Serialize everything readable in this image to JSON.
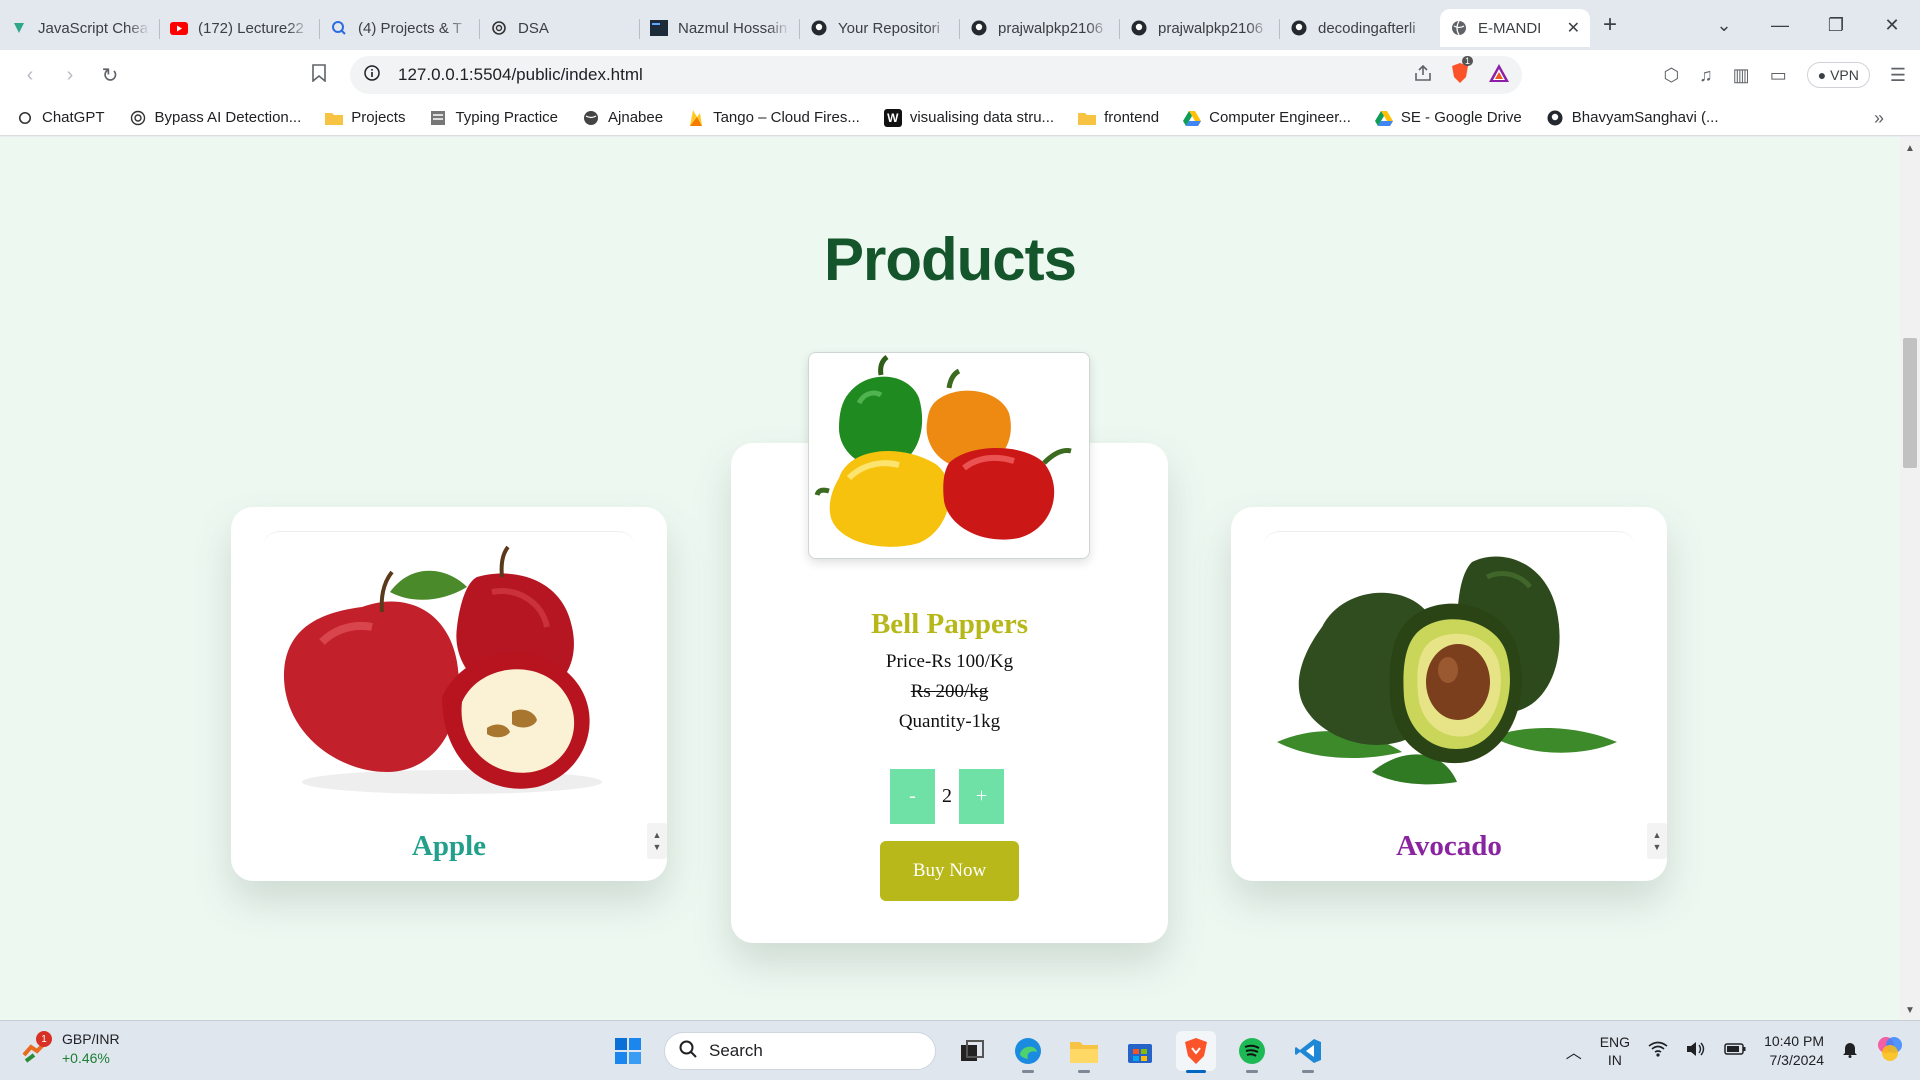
{
  "browser": {
    "tabs": [
      {
        "title": "JavaScript Chea",
        "icon": "javascript-site-icon",
        "active": false
      },
      {
        "title": "(172) Lecture22",
        "icon": "youtube-icon",
        "active": false
      },
      {
        "title": "(4) Projects & T",
        "icon": "projects-site-icon",
        "active": false
      },
      {
        "title": "DSA",
        "icon": "chatgpt-icon",
        "active": false
      },
      {
        "title": "Nazmul Hossain",
        "icon": "portfolio-site-icon",
        "active": false
      },
      {
        "title": "Your Repositori",
        "icon": "github-icon",
        "active": false
      },
      {
        "title": "prajwalpkp2106",
        "icon": "github-icon",
        "active": false
      },
      {
        "title": "prajwalpkp2106",
        "icon": "github-icon",
        "active": false
      },
      {
        "title": "decodingafterli",
        "icon": "github-icon",
        "active": false
      },
      {
        "title": "E-MANDI",
        "icon": "globe-icon",
        "active": true
      }
    ],
    "url": "127.0.0.1:5504/public/index.html",
    "vpn_label": "VPN",
    "shields_count": "1",
    "bookmarks": [
      {
        "label": "ChatGPT",
        "icon": "chatgpt-icon"
      },
      {
        "label": "Bypass AI Detection...",
        "icon": "bypass-site-icon"
      },
      {
        "label": "Projects",
        "icon": "folder-icon"
      },
      {
        "label": "Typing Practice",
        "icon": "typing-site-icon"
      },
      {
        "label": "Ajnabee",
        "icon": "globe-icon"
      },
      {
        "label": "Tango – Cloud Fires...",
        "icon": "firebase-icon"
      },
      {
        "label": "visualising data stru...",
        "icon": "visualgo-icon"
      },
      {
        "label": "frontend",
        "icon": "folder-icon"
      },
      {
        "label": "Computer Engineer...",
        "icon": "google-drive-icon"
      },
      {
        "label": "SE - Google Drive",
        "icon": "google-drive-icon"
      },
      {
        "label": "BhavyamSanghavi (...",
        "icon": "github-icon"
      }
    ]
  },
  "page": {
    "heading": "Products",
    "colors": {
      "background": "#edf8f1",
      "heading": "#14552b",
      "stepper": "#6fe0a6",
      "buy_button": "#b9b81a"
    },
    "products": [
      {
        "name": "Apple",
        "name_color": "#22a08b",
        "image": "apple-image"
      },
      {
        "name": "Bell Pappers",
        "name_color": "#b6b81a",
        "image": "bell-pepper-image",
        "price": "Price-Rs 100/Kg",
        "mrp": "Rs 200/kg",
        "quantity": "Quantity-1kg",
        "stepper": {
          "minus": "-",
          "value": "2",
          "plus": "+"
        },
        "buy_label": "Buy Now"
      },
      {
        "name": "Avocado",
        "name_color": "#8a24a0",
        "image": "avocado-image"
      }
    ]
  },
  "taskbar": {
    "widget": {
      "title": "GBP/INR",
      "change": "+0.46%",
      "badge": "1"
    },
    "search_placeholder": "Search",
    "pinned": [
      "windows-start-icon",
      "task-view-icon",
      "edge-icon",
      "file-explorer-icon",
      "store-icon",
      "brave-icon",
      "spotify-icon",
      "vscode-icon"
    ],
    "language": {
      "line1": "ENG",
      "line2": "IN"
    },
    "time": "10:40 PM",
    "date": "7/3/2024"
  }
}
